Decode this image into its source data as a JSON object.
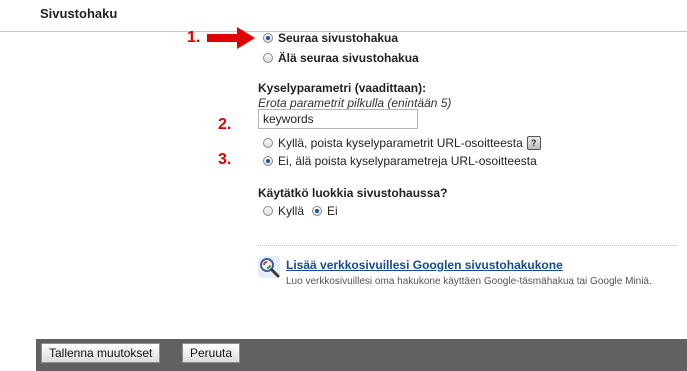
{
  "section": {
    "title": "Sivustohaku"
  },
  "annotations": [
    "1.",
    "2.",
    "3."
  ],
  "follow": {
    "option_follow": "Seuraa sivustohakua",
    "option_no_follow": "Älä seuraa sivustohakua",
    "selected": "follow"
  },
  "query_param": {
    "label": "Kyselyparametri (vaadittaan):",
    "hint": "Erota parametrit pilkulla (enintään 5)",
    "value": "keywords",
    "option_strip": "Kyllä, poista kyselyparametrit URL-osoitteesta",
    "help_label": "?",
    "option_keep": "Ei, älä poista kyselyparametreja URL-osoitteesta",
    "selected": "keep"
  },
  "categories": {
    "question": "Käytätkö luokkia sivustohaussa?",
    "yes": "Kyllä",
    "no": "Ei",
    "selected": "no"
  },
  "promo": {
    "link": "Lisää verkkosivuillesi Googlen sivustohakukone",
    "description": "Luo verkkosivuillesi oma hakukone käyttäen Google-täsmähakua tai Google Miniä."
  },
  "footer": {
    "save": "Tallenna muutokset",
    "cancel": "Peruuta"
  }
}
